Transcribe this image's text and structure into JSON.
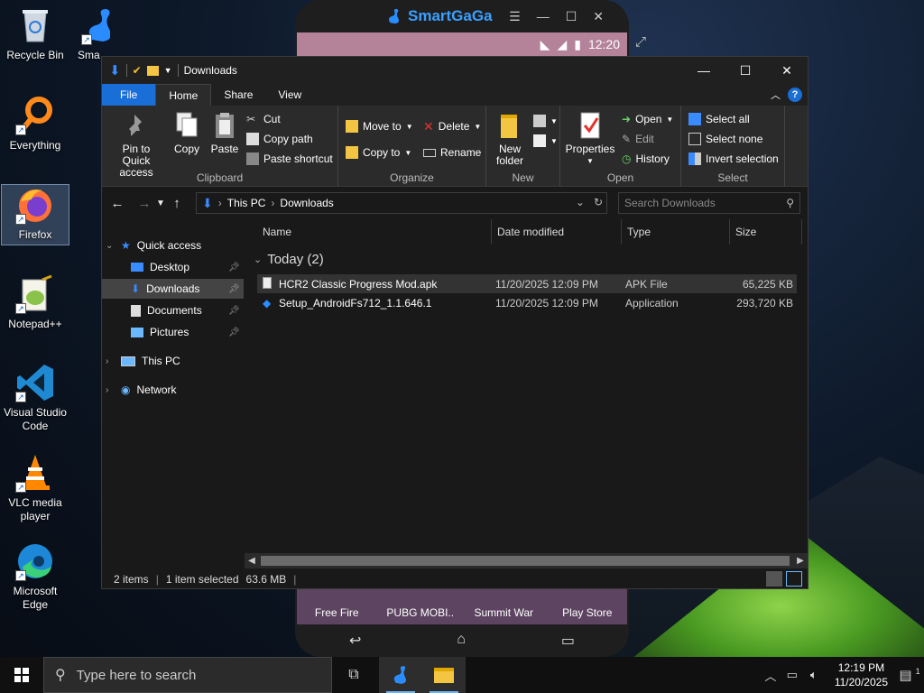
{
  "desktop": {
    "icons": [
      {
        "label": "Recycle Bin"
      },
      {
        "label": "Sma"
      },
      {
        "label": "Everything"
      },
      {
        "label": "Firefox"
      },
      {
        "label": "Notepad++"
      },
      {
        "label": "Visual Studio Code"
      },
      {
        "label": "VLC media player"
      },
      {
        "label": "Microsoft Edge"
      }
    ]
  },
  "emulator": {
    "brand": "SmartGaGa",
    "time": "12:20",
    "apps": [
      {
        "label": "Free Fire"
      },
      {
        "label": "PUBG MOBI.."
      },
      {
        "label": "Summit War"
      },
      {
        "label": "Play Store"
      }
    ]
  },
  "explorer": {
    "title": "Downloads",
    "tabs": {
      "file": "File",
      "home": "Home",
      "share": "Share",
      "view": "View"
    },
    "clipboard": {
      "label": "Clipboard",
      "pin": "Pin to Quick access",
      "copy": "Copy",
      "paste": "Paste",
      "cut": "Cut",
      "copy_path": "Copy path",
      "paste_shortcut": "Paste shortcut"
    },
    "organize": {
      "label": "Organize",
      "move_to": "Move to",
      "copy_to": "Copy to",
      "delete": "Delete",
      "rename": "Rename"
    },
    "new": {
      "label": "New",
      "new_folder": "New folder"
    },
    "open": {
      "label": "Open",
      "properties": "Properties",
      "open": "Open",
      "edit": "Edit",
      "history": "History"
    },
    "select": {
      "label": "Select",
      "select_all": "Select all",
      "select_none": "Select none",
      "invert": "Invert selection"
    },
    "address": {
      "this_pc": "This PC",
      "folder": "Downloads"
    },
    "search_placeholder": "Search Downloads",
    "nav": {
      "quick_access": "Quick access",
      "desktop": "Desktop",
      "downloads": "Downloads",
      "documents": "Documents",
      "pictures": "Pictures",
      "this_pc": "This PC",
      "network": "Network"
    },
    "columns": {
      "name": "Name",
      "date": "Date modified",
      "type": "Type",
      "size": "Size"
    },
    "group": "Today (2)",
    "files": [
      {
        "name": "HCR2 Classic Progress Mod.apk",
        "date": "11/20/2025 12:09 PM",
        "type": "APK File",
        "size": "65,225 KB"
      },
      {
        "name": "Setup_AndroidFs712_1.1.646.1",
        "date": "11/20/2025 12:09 PM",
        "type": "Application",
        "size": "293,720 KB"
      }
    ],
    "status": {
      "items": "2 items",
      "selected": "1 item selected",
      "size": "63.6 MB"
    }
  },
  "taskbar": {
    "search_placeholder": "Type here to search",
    "time": "12:19 PM",
    "date": "11/20/2025",
    "notifications": "1"
  }
}
